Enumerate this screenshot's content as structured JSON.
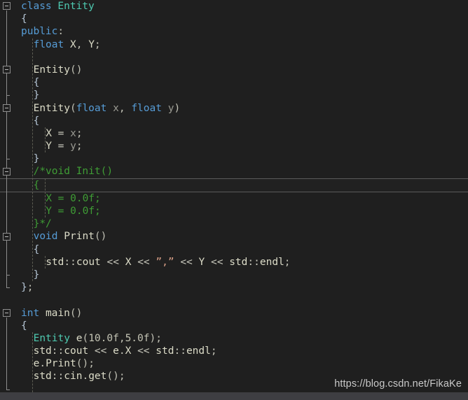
{
  "editor": {
    "app": "visual-studio-code-editor",
    "language": "cpp",
    "background_color": "#1f1f1f",
    "current_line_number": 14,
    "colors": {
      "background": "#1f1f1f",
      "keyword": "#569cd6",
      "type": "#4ec9b0",
      "identifier": "#dcdcc8",
      "parameter": "#9a9a92",
      "comment": "#3f9c35",
      "string": "#d69d85",
      "brace": "#b4c4d4",
      "current_line_border": "#5a5a5a",
      "indent_guide": "#5c5c52",
      "fold_marker": "#8d8d8d",
      "scrollbar": "#3e3e42",
      "watermark_text": "#c9c9c9"
    }
  },
  "watermark": {
    "text": "https://blog.csdn.net/FikaKe"
  },
  "code_lines": [
    {
      "n": 1,
      "indent": 0,
      "current": false,
      "tokens": [
        {
          "t": "class",
          "c": "kw"
        },
        {
          "t": " ",
          "c": "punc"
        },
        {
          "t": "Entity",
          "c": "type"
        }
      ]
    },
    {
      "n": 2,
      "indent": 0,
      "current": false,
      "tokens": [
        {
          "t": "{",
          "c": "brace"
        }
      ]
    },
    {
      "n": 3,
      "indent": 0,
      "current": false,
      "tokens": [
        {
          "t": "public",
          "c": "kw"
        },
        {
          "t": ":",
          "c": "punc"
        }
      ]
    },
    {
      "n": 4,
      "indent": 1,
      "current": false,
      "tokens": [
        {
          "t": "float",
          "c": "kw"
        },
        {
          "t": " ",
          "c": "punc"
        },
        {
          "t": "X",
          "c": "id"
        },
        {
          "t": ",",
          "c": "punc"
        },
        {
          "t": " ",
          "c": "punc"
        },
        {
          "t": "Y",
          "c": "id"
        },
        {
          "t": ";",
          "c": "punc"
        }
      ]
    },
    {
      "n": 5,
      "indent": 0,
      "current": false,
      "tokens": []
    },
    {
      "n": 6,
      "indent": 1,
      "current": false,
      "tokens": [
        {
          "t": "Entity",
          "c": "fn"
        },
        {
          "t": "()",
          "c": "punc"
        }
      ]
    },
    {
      "n": 7,
      "indent": 1,
      "current": false,
      "tokens": [
        {
          "t": "{",
          "c": "brace"
        }
      ]
    },
    {
      "n": 8,
      "indent": 1,
      "current": false,
      "tokens": [
        {
          "t": "}",
          "c": "brace"
        }
      ]
    },
    {
      "n": 9,
      "indent": 1,
      "current": false,
      "tokens": [
        {
          "t": "Entity",
          "c": "fn"
        },
        {
          "t": "(",
          "c": "punc"
        },
        {
          "t": "float",
          "c": "kw"
        },
        {
          "t": " ",
          "c": "punc"
        },
        {
          "t": "x",
          "c": "param"
        },
        {
          "t": ",",
          "c": "punc"
        },
        {
          "t": " ",
          "c": "punc"
        },
        {
          "t": "float",
          "c": "kw"
        },
        {
          "t": " ",
          "c": "punc"
        },
        {
          "t": "y",
          "c": "param"
        },
        {
          "t": ")",
          "c": "punc"
        }
      ]
    },
    {
      "n": 10,
      "indent": 1,
      "current": false,
      "tokens": [
        {
          "t": "{",
          "c": "brace"
        }
      ]
    },
    {
      "n": 11,
      "indent": 2,
      "current": false,
      "tokens": [
        {
          "t": "X",
          "c": "id"
        },
        {
          "t": " ",
          "c": "punc"
        },
        {
          "t": "=",
          "c": "op"
        },
        {
          "t": " ",
          "c": "punc"
        },
        {
          "t": "x",
          "c": "param"
        },
        {
          "t": ";",
          "c": "punc"
        }
      ]
    },
    {
      "n": 12,
      "indent": 2,
      "current": false,
      "tokens": [
        {
          "t": "Y",
          "c": "id"
        },
        {
          "t": " ",
          "c": "punc"
        },
        {
          "t": "=",
          "c": "op"
        },
        {
          "t": " ",
          "c": "punc"
        },
        {
          "t": "y",
          "c": "param"
        },
        {
          "t": ";",
          "c": "punc"
        }
      ]
    },
    {
      "n": 13,
      "indent": 1,
      "current": false,
      "tokens": [
        {
          "t": "}",
          "c": "brace"
        }
      ]
    },
    {
      "n": 14,
      "indent": 1,
      "current": false,
      "tokens": [
        {
          "t": "/*void Init()",
          "c": "cmt"
        }
      ]
    },
    {
      "n": 15,
      "indent": 1,
      "current": true,
      "tokens": [
        {
          "t": "{",
          "c": "cmt"
        }
      ]
    },
    {
      "n": 16,
      "indent": 2,
      "current": false,
      "tokens": [
        {
          "t": "X = 0.0f;",
          "c": "cmt"
        }
      ]
    },
    {
      "n": 17,
      "indent": 2,
      "current": false,
      "tokens": [
        {
          "t": "Y = 0.0f;",
          "c": "cmt"
        }
      ]
    },
    {
      "n": 18,
      "indent": 1,
      "current": false,
      "tokens": [
        {
          "t": "}*/",
          "c": "cmt"
        }
      ]
    },
    {
      "n": 19,
      "indent": 1,
      "current": false,
      "tokens": [
        {
          "t": "void",
          "c": "kw"
        },
        {
          "t": " ",
          "c": "punc"
        },
        {
          "t": "Print",
          "c": "fn"
        },
        {
          "t": "()",
          "c": "punc"
        }
      ]
    },
    {
      "n": 20,
      "indent": 1,
      "current": false,
      "tokens": [
        {
          "t": "{",
          "c": "brace"
        }
      ]
    },
    {
      "n": 21,
      "indent": 2,
      "current": false,
      "tokens": [
        {
          "t": "std",
          "c": "id"
        },
        {
          "t": "::",
          "c": "op"
        },
        {
          "t": "cout",
          "c": "id"
        },
        {
          "t": " ",
          "c": "punc"
        },
        {
          "t": "<<",
          "c": "op"
        },
        {
          "t": " ",
          "c": "punc"
        },
        {
          "t": "X",
          "c": "id"
        },
        {
          "t": " ",
          "c": "punc"
        },
        {
          "t": "<<",
          "c": "op"
        },
        {
          "t": " ",
          "c": "punc"
        },
        {
          "t": "”,”",
          "c": "str"
        },
        {
          "t": " ",
          "c": "punc"
        },
        {
          "t": "<<",
          "c": "op"
        },
        {
          "t": " ",
          "c": "punc"
        },
        {
          "t": "Y",
          "c": "id"
        },
        {
          "t": " ",
          "c": "punc"
        },
        {
          "t": "<<",
          "c": "op"
        },
        {
          "t": " ",
          "c": "punc"
        },
        {
          "t": "std",
          "c": "id"
        },
        {
          "t": "::",
          "c": "op"
        },
        {
          "t": "endl",
          "c": "id"
        },
        {
          "t": ";",
          "c": "punc"
        }
      ]
    },
    {
      "n": 22,
      "indent": 1,
      "current": false,
      "tokens": [
        {
          "t": "}",
          "c": "brace"
        }
      ]
    },
    {
      "n": 23,
      "indent": 0,
      "current": false,
      "tokens": [
        {
          "t": "}",
          "c": "brace"
        },
        {
          "t": ";",
          "c": "punc"
        }
      ]
    },
    {
      "n": 24,
      "indent": 0,
      "current": false,
      "tokens": []
    },
    {
      "n": 25,
      "indent": 0,
      "current": false,
      "tokens": [
        {
          "t": "int",
          "c": "kw"
        },
        {
          "t": " ",
          "c": "punc"
        },
        {
          "t": "main",
          "c": "fn"
        },
        {
          "t": "()",
          "c": "punc"
        }
      ]
    },
    {
      "n": 26,
      "indent": 0,
      "current": false,
      "tokens": [
        {
          "t": "{",
          "c": "brace"
        }
      ]
    },
    {
      "n": 27,
      "indent": 1,
      "current": false,
      "tokens": [
        {
          "t": "Entity",
          "c": "type"
        },
        {
          "t": " ",
          "c": "punc"
        },
        {
          "t": "e",
          "c": "id"
        },
        {
          "t": "(",
          "c": "punc"
        },
        {
          "t": "10.0f",
          "c": "num"
        },
        {
          "t": ",",
          "c": "punc"
        },
        {
          "t": "5.0f",
          "c": "num"
        },
        {
          "t": ")",
          "c": "punc"
        },
        {
          "t": ";",
          "c": "punc"
        }
      ]
    },
    {
      "n": 28,
      "indent": 1,
      "current": false,
      "tokens": [
        {
          "t": "std",
          "c": "id"
        },
        {
          "t": "::",
          "c": "op"
        },
        {
          "t": "cout",
          "c": "id"
        },
        {
          "t": " ",
          "c": "punc"
        },
        {
          "t": "<<",
          "c": "op"
        },
        {
          "t": " ",
          "c": "punc"
        },
        {
          "t": "e",
          "c": "id"
        },
        {
          "t": ".",
          "c": "op"
        },
        {
          "t": "X",
          "c": "id"
        },
        {
          "t": " ",
          "c": "punc"
        },
        {
          "t": "<<",
          "c": "op"
        },
        {
          "t": " ",
          "c": "punc"
        },
        {
          "t": "std",
          "c": "id"
        },
        {
          "t": "::",
          "c": "op"
        },
        {
          "t": "endl",
          "c": "id"
        },
        {
          "t": ";",
          "c": "punc"
        }
      ]
    },
    {
      "n": 29,
      "indent": 1,
      "current": false,
      "tokens": [
        {
          "t": "e",
          "c": "id"
        },
        {
          "t": ".",
          "c": "op"
        },
        {
          "t": "Print",
          "c": "fn"
        },
        {
          "t": "()",
          "c": "punc"
        },
        {
          "t": ";",
          "c": "punc"
        }
      ]
    },
    {
      "n": 30,
      "indent": 1,
      "current": false,
      "tokens": [
        {
          "t": "std",
          "c": "id"
        },
        {
          "t": "::",
          "c": "op"
        },
        {
          "t": "cin",
          "c": "id"
        },
        {
          "t": ".",
          "c": "op"
        },
        {
          "t": "get",
          "c": "fn"
        },
        {
          "t": "()",
          "c": "punc"
        },
        {
          "t": ";",
          "c": "punc"
        }
      ]
    },
    {
      "n": 31,
      "indent": 1,
      "current": false,
      "tokens": []
    }
  ],
  "fold_markers": [
    {
      "name": "fold-class-entity",
      "line": 1,
      "has_line": true,
      "span_lines": 22
    },
    {
      "name": "fold-entity-ctor-default",
      "line": 6,
      "has_line": true,
      "span_lines": 2
    },
    {
      "name": "fold-entity-ctor-args",
      "line": 9,
      "has_line": true,
      "span_lines": 4
    },
    {
      "name": "fold-comment-init",
      "line": 14,
      "has_line": false,
      "span_lines": 0
    },
    {
      "name": "fold-print-method",
      "line": 19,
      "has_line": true,
      "span_lines": 3
    },
    {
      "name": "fold-main-function",
      "line": 25,
      "has_line": true,
      "span_lines": 6
    }
  ],
  "indent_guides": [
    {
      "col": 1,
      "from_line": 4,
      "to_line": 22
    },
    {
      "col": 2,
      "from_line": 11,
      "to_line": 12
    },
    {
      "col": 2,
      "from_line": 15,
      "to_line": 17
    },
    {
      "col": 2,
      "from_line": 21,
      "to_line": 21
    },
    {
      "col": 1,
      "from_line": 27,
      "to_line": 31
    }
  ],
  "scrollbar": {
    "name": "horizontal-scrollbar",
    "orientation": "horizontal"
  }
}
